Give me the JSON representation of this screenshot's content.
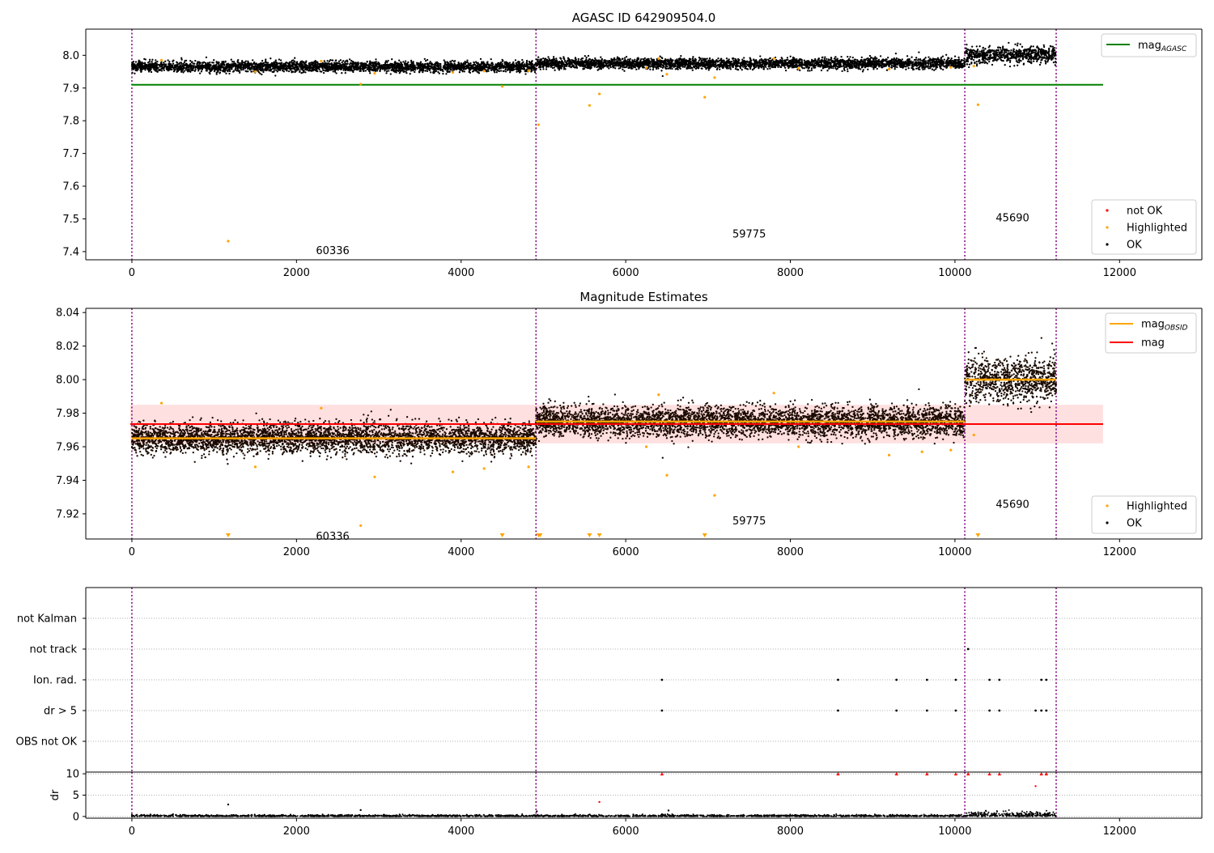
{
  "chart_data": [
    {
      "type": "scatter",
      "title": "AGASC ID 642909504.0",
      "xlim": [
        -560,
        13000
      ],
      "ylim": [
        7.375,
        8.08
      ],
      "x_ticks": [
        0,
        2000,
        4000,
        6000,
        8000,
        10000,
        12000
      ],
      "y_ticks": [
        7.4,
        7.5,
        7.6,
        7.7,
        7.8,
        7.9,
        8.0
      ],
      "y_tick_labels": [
        "7.4",
        "7.5",
        "7.6",
        "7.7",
        "7.8",
        "7.9",
        "8.0"
      ],
      "segments": [
        {
          "label": "60336",
          "x_start": 0,
          "x_end": 4910,
          "center": 7.965,
          "spread": 0.008,
          "label_y": 7.405
        },
        {
          "label": "59775",
          "x_start": 4910,
          "x_end": 10120,
          "center": 7.975,
          "spread": 0.008,
          "label_y": 7.455
        },
        {
          "label": "45690",
          "x_start": 10120,
          "x_end": 11230,
          "center": 8.0,
          "spread": 0.012,
          "label_y": 7.505
        }
      ],
      "vlines": [
        0,
        4910,
        10120,
        11230
      ],
      "hline": {
        "y": 7.91,
        "x_start": 0,
        "x_end": 11800
      },
      "highlighted": [
        {
          "x": 1170,
          "y": 7.432
        },
        {
          "x": 4500,
          "y": 7.905
        },
        {
          "x": 2780,
          "y": 7.912
        },
        {
          "x": 4940,
          "y": 7.788
        },
        {
          "x": 5560,
          "y": 7.847
        },
        {
          "x": 5680,
          "y": 7.882
        },
        {
          "x": 6500,
          "y": 7.942
        },
        {
          "x": 6960,
          "y": 7.872
        },
        {
          "x": 7080,
          "y": 7.932
        },
        {
          "x": 10280,
          "y": 7.849
        },
        {
          "x": 10230,
          "y": 7.967
        },
        {
          "x": 360,
          "y": 7.985
        },
        {
          "x": 1500,
          "y": 7.95
        },
        {
          "x": 2300,
          "y": 7.982
        },
        {
          "x": 2950,
          "y": 7.945
        },
        {
          "x": 3900,
          "y": 7.948
        },
        {
          "x": 4280,
          "y": 7.952
        },
        {
          "x": 4820,
          "y": 7.953
        },
        {
          "x": 6250,
          "y": 7.962
        },
        {
          "x": 8100,
          "y": 7.96
        },
        {
          "x": 9200,
          "y": 7.958
        },
        {
          "x": 9950,
          "y": 7.963
        },
        {
          "x": 7800,
          "y": 7.99
        },
        {
          "x": 6400,
          "y": 7.99
        }
      ],
      "legend_upper": [
        {
          "label": "mag",
          "sub": "AGASC",
          "color": "#008000"
        }
      ],
      "legend_lower": [
        {
          "label": "not OK",
          "color": "#ff0000"
        },
        {
          "label": "Highlighted",
          "color": "#ffa500"
        },
        {
          "label": "OK",
          "color": "#000000"
        }
      ]
    },
    {
      "type": "scatter",
      "title": "Magnitude Estimates",
      "xlim": [
        -560,
        13000
      ],
      "ylim": [
        7.905,
        8.0425
      ],
      "x_ticks": [
        0,
        2000,
        4000,
        6000,
        8000,
        10000,
        12000
      ],
      "y_ticks": [
        7.92,
        7.94,
        7.96,
        7.98,
        8.0,
        8.02,
        8.04
      ],
      "y_tick_labels": [
        "7.92",
        "7.94",
        "7.96",
        "7.98",
        "8.00",
        "8.02",
        "8.04"
      ],
      "segments": [
        {
          "label": "60336",
          "x_start": 0,
          "x_end": 4910,
          "center": 7.965,
          "spread": 0.0045,
          "label_y": 7.907,
          "mean": 7.965
        },
        {
          "label": "59775",
          "x_start": 4910,
          "x_end": 10120,
          "center": 7.975,
          "spread": 0.0045,
          "label_y": 7.916,
          "mean": 7.975
        },
        {
          "label": "45690",
          "x_start": 10120,
          "x_end": 11230,
          "center": 8.0,
          "spread": 0.0065,
          "label_y": 7.926,
          "mean": 8.0
        }
      ],
      "vlines": [
        0,
        4910,
        10120,
        11230
      ],
      "mag_line": {
        "y": 7.9735,
        "x_start": -20,
        "x_end": 11800
      },
      "mag_band": {
        "y_low": 7.962,
        "y_high": 7.985,
        "x_start": -20,
        "x_end": 11800
      },
      "highlighted": [
        {
          "x": 360,
          "y": 7.986
        },
        {
          "x": 2780,
          "y": 7.913
        },
        {
          "x": 2950,
          "y": 7.942
        },
        {
          "x": 3900,
          "y": 7.945
        },
        {
          "x": 4280,
          "y": 7.947
        },
        {
          "x": 4820,
          "y": 7.948
        },
        {
          "x": 6500,
          "y": 7.943
        },
        {
          "x": 7080,
          "y": 7.931
        },
        {
          "x": 1500,
          "y": 7.948
        },
        {
          "x": 2300,
          "y": 7.983
        },
        {
          "x": 6250,
          "y": 7.96
        },
        {
          "x": 8100,
          "y": 7.96
        },
        {
          "x": 9200,
          "y": 7.955
        },
        {
          "x": 9950,
          "y": 7.958
        },
        {
          "x": 7800,
          "y": 7.992
        },
        {
          "x": 6400,
          "y": 7.991
        },
        {
          "x": 10230,
          "y": 7.967
        },
        {
          "x": 9600,
          "y": 7.957
        }
      ],
      "offscale_markers": [
        1170,
        4500,
        4940,
        4960,
        5560,
        5680,
        6960,
        10280
      ],
      "legend_upper": [
        {
          "label": "mag",
          "sub": "OBSID",
          "color": "#ffa500"
        },
        {
          "label": "mag",
          "sub": "",
          "color": "#ff0000"
        }
      ],
      "legend_lower": [
        {
          "label": "Highlighted",
          "color": "#ffa500"
        },
        {
          "label": "OK",
          "color": "#000000"
        }
      ]
    },
    {
      "type": "scatter",
      "title": "",
      "xlim": [
        -560,
        13000
      ],
      "categories": [
        "not Kalman",
        "not track",
        "Ion. rad.",
        "dr > 5",
        "OBS not OK"
      ],
      "flags": {
        "not track": [
          10160
        ],
        "Ion. rad.": [
          6440,
          8580,
          9290,
          9660,
          10010,
          10420,
          10540,
          11050,
          11110
        ],
        "dr > 5": [
          6440,
          8580,
          9290,
          9660,
          10010,
          10420,
          10540,
          10980,
          11050,
          11110
        ]
      },
      "vlines": [
        0,
        4910,
        10120,
        11230
      ]
    },
    {
      "type": "scatter",
      "title": "",
      "xlim": [
        -560,
        13000
      ],
      "ylim": [
        -0.4,
        10.4
      ],
      "ylabel": "dr",
      "y_ticks": [
        0,
        5,
        10
      ],
      "y_tick_labels": [
        "0",
        "5",
        "10"
      ],
      "x_ticks": [
        0,
        2000,
        4000,
        6000,
        8000,
        10000,
        12000
      ],
      "x_tick_labels": [
        "0",
        "2000",
        "4000",
        "6000",
        "8000",
        "10000",
        "12000"
      ],
      "outliers": [
        {
          "x": 1170,
          "y": 2.8
        },
        {
          "x": 2780,
          "y": 1.5
        },
        {
          "x": 5680,
          "y": 3.4
        },
        {
          "x": 4920,
          "y": 1.2
        },
        {
          "x": 6520,
          "y": 1.4
        }
      ],
      "flagged_high": [
        6440,
        8580,
        9290,
        9660,
        10010,
        10160,
        10420,
        10540,
        11050,
        11110
      ],
      "flagged_mid": [
        {
          "x": 10980,
          "y": 7.1
        }
      ],
      "vlines": [
        0,
        4910,
        10120,
        11230
      ]
    }
  ]
}
